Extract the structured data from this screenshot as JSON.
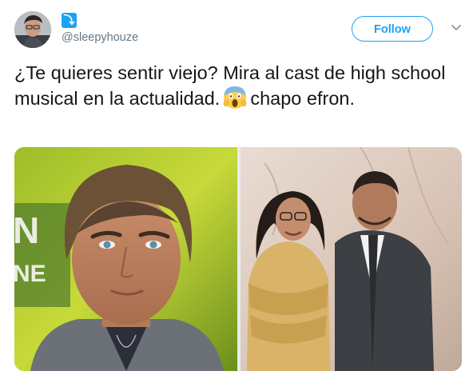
{
  "tweet": {
    "badge_glyph": "⤵",
    "handle": "@sleepyhouze",
    "follow_label": "Follow",
    "text_before": "¿Te quieres sentir viejo? Mira al cast de high school musical en la actualidad.",
    "emoji": "face-screaming-in-fear",
    "text_after": "chapo efron."
  },
  "media": {
    "left_photo": "young-man-portrait",
    "right_photo": "couple-portrait"
  },
  "colors": {
    "accent": "#1da1f2",
    "text": "#14171a",
    "secondary_text": "#657786"
  }
}
